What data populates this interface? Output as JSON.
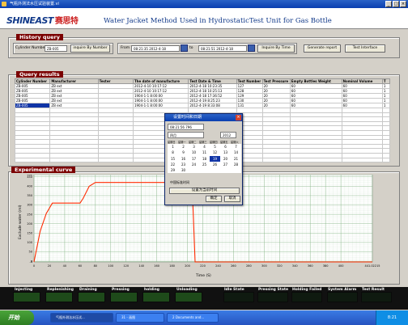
{
  "window": {
    "title": "气瓶外测法水压试验装置.vi"
  },
  "header": {
    "logo_en": "SHINEAST",
    "logo_cn": "赛思特",
    "title": "Water Jacket Method Used in HydrostaticTest Unit for Gas Bottle"
  },
  "history": {
    "label": "History query",
    "cyl_label": "Cylinder Number",
    "cyl_value": "ZB-005",
    "inquire_number": "inquire By Number",
    "from_label": "From",
    "from_value": "08:21:35 2012-4-18",
    "to_label": "to",
    "to_value": "08:21:51 2012-4-18",
    "inquire_time": "Inquire By Time",
    "generate": "Generate report",
    "test_interface": "Test Interface"
  },
  "results": {
    "label": "Query results",
    "columns": [
      "Cylinder Number",
      "Manufacturer",
      "Tester",
      "The date of manufacture",
      "Test Date & Time",
      "Test Number",
      "Test Pressure",
      "Empty Bottles Weight",
      "Nominal Volume",
      "T"
    ],
    "rows": [
      [
        "ZB-005",
        "ZB ext",
        "",
        "2012-4-10 10:17:12",
        "2012-4-18 10:23:35",
        "127",
        "20",
        "60",
        "60",
        "1"
      ],
      [
        "ZB-005",
        "ZB ext",
        "",
        "2012-4-10 10:17:12",
        "2012-4-18 10:25:13",
        "128",
        "20",
        "60",
        "60",
        "1"
      ],
      [
        "ZB-005",
        "ZB ext",
        "",
        "1904-1-1 8:00:00",
        "2012-4-18 17:36:52",
        "129",
        "20",
        "60",
        "60",
        "1"
      ],
      [
        "ZB-005",
        "ZB ext",
        "",
        "1904-1-1 8:00:00",
        "2012-4-19 8:25:23",
        "130",
        "20",
        "60",
        "60",
        "1"
      ],
      [
        "ZB-005",
        "ZB ext",
        "",
        "1904-1-1 8:00:00",
        "2012-4-19 8:33:08",
        "131",
        "20",
        "60",
        "60",
        "1"
      ]
    ]
  },
  "chart": {
    "label": "Experimental curve",
    "xlabel": "Time (S)",
    "ylabel": "Exclude water (ml)"
  },
  "chart_data": {
    "type": "line",
    "x": [
      0,
      8,
      16,
      24,
      30,
      40,
      50,
      60,
      64,
      72,
      80,
      90,
      100,
      150,
      200,
      206,
      210,
      212,
      220,
      300,
      400,
      441
    ],
    "y": [
      -4,
      160,
      255,
      310,
      310,
      310,
      310,
      310,
      335,
      400,
      420,
      420,
      420,
      420,
      420,
      420,
      -4,
      -4,
      -4,
      -4,
      -4,
      -4
    ],
    "xlim": [
      0,
      441.02215
    ],
    "ylim": [
      -4,
      462
    ],
    "xticks": [
      "0",
      "20",
      "40",
      "60",
      "80",
      "100",
      "120",
      "140",
      "160",
      "180",
      "200",
      "220",
      "240",
      "260",
      "280",
      "300",
      "320",
      "340",
      "360",
      "380",
      "400",
      "441.02215"
    ],
    "yticks": [
      "462",
      "450",
      "400",
      "350",
      "300",
      "250",
      "200",
      "150",
      "100",
      "50",
      "0",
      "-4"
    ],
    "grid": true,
    "line_color": "#ff2a00"
  },
  "dialog": {
    "title": "设置时间和日期",
    "time_value": "08:21:56 796",
    "month": "四月",
    "year": "2012",
    "weekdays": [
      "星期日",
      "星期一",
      "星期二",
      "星期三",
      "星期四",
      "星期五",
      "星期六"
    ],
    "days": [
      "1",
      "2",
      "3",
      "4",
      "5",
      "6",
      "7",
      "8",
      "9",
      "10",
      "11",
      "12",
      "13",
      "14",
      "15",
      "16",
      "17",
      "18",
      "19",
      "20",
      "21",
      "22",
      "23",
      "24",
      "25",
      "26",
      "27",
      "28",
      "29",
      "30"
    ],
    "today_index": 18,
    "zone": "中国标准时间",
    "set_now": "设置为当前时间",
    "ok": "确定",
    "cancel": "取消"
  },
  "status": {
    "left": [
      "Injecting",
      "Replenishing",
      "Draining",
      "Pressing",
      "holding",
      "Unloading"
    ],
    "right": [
      "Idle State",
      "Pressing State",
      "Holding Failed",
      "System Alarm",
      "Test Result"
    ]
  },
  "taskbar": {
    "start": "开始",
    "tasks": [
      "气瓶外测法水压试...",
      "31 - 画图",
      "2 Documents and..."
    ],
    "clock": "8:21"
  }
}
